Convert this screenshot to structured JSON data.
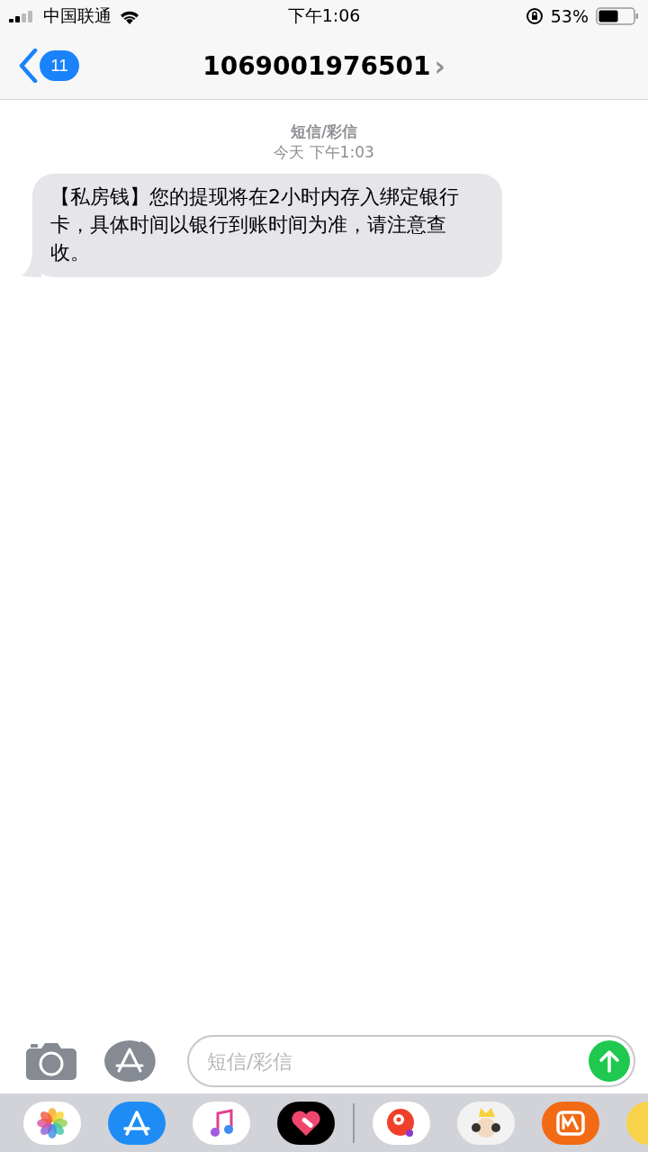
{
  "status_bar": {
    "carrier": "中国联通",
    "time": "下午1:06",
    "battery": "53%"
  },
  "nav": {
    "back_count": "11",
    "title": "1069001976501",
    "chevron": "›"
  },
  "thread": {
    "service": "短信/彩信",
    "timestamp": "今天 下午1:03",
    "messages": [
      {
        "text": "【私房钱】您的提现将在2小时内存入绑定银行卡，具体时间以银行到账时间为准，请注意查收。"
      }
    ]
  },
  "composer": {
    "placeholder": "短信/彩信"
  }
}
